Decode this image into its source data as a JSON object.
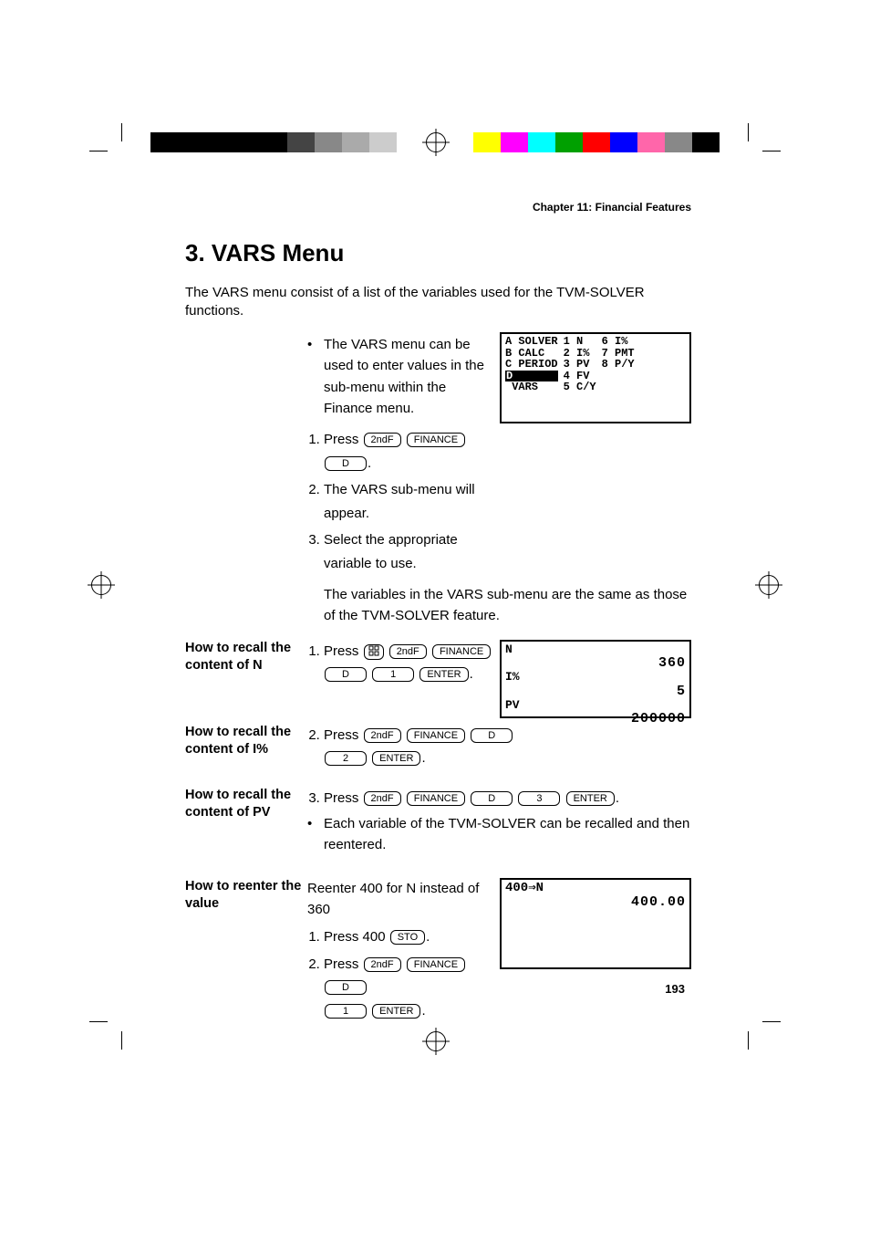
{
  "header": {
    "chapter": "Chapter 11: Financial Features"
  },
  "title": "3. VARS Menu",
  "intro": "The VARS menu consist of a list of the variables used for the TVM-SOLVER functions.",
  "bullet1": "The VARS menu can be used to enter values in the sub-menu within the Finance menu.",
  "steps_main": {
    "s1_a": "Press ",
    "s1_end": ".",
    "s2": "The VARS sub-menu will appear.",
    "s3": "Select the appropriate variable to use.",
    "note": "The variables in the VARS sub-menu are the same as those of the TVM-SOLVER feature."
  },
  "keys": {
    "secondF": "2ndF",
    "finance": "FINANCE",
    "D": "D",
    "one": "1",
    "two": "2",
    "three": "3",
    "enter": "ENTER",
    "sto": "STO"
  },
  "screen1": {
    "colA": [
      "A SOLVER",
      "B CALC",
      "C PERIOD",
      "D VARS"
    ],
    "colB": [
      "1 N",
      "2 I%",
      "3 PV",
      "4 FV",
      "5 C/Y"
    ],
    "colC": [
      "6 I%",
      "7 PMT",
      "8 P/Y"
    ]
  },
  "labels": {
    "recallN": "How to recall the content of N",
    "recallI": "How to recall the content of I%",
    "recallPV": "How to recall the content of PV",
    "reenter": "How to reenter the value"
  },
  "recallN": {
    "pre": "Press ",
    "post": "."
  },
  "recallI": {
    "pre": "Press ",
    "post": "."
  },
  "recallPV": {
    "pre": "Press ",
    "post": ".",
    "bullet": "Each variable of the TVM-SOLVER can be recalled and then reentered."
  },
  "reenter": {
    "heading": "Reenter 400 for N instead of 360",
    "s1_pre": "Press 400 ",
    "s1_post": ".",
    "s2_pre": "Press ",
    "s2_post": "."
  },
  "screen2": {
    "rows": [
      {
        "l": "N",
        "r": "360"
      },
      {
        "l": "I%",
        "r": "5"
      },
      {
        "l": "PV",
        "r": "200000"
      }
    ]
  },
  "screen3": {
    "line1_l": "400⇒N",
    "line1_r": "",
    "line2_r": "400.00"
  },
  "page_number": "193",
  "grey_shades": [
    "#000000",
    "#000000",
    "#000000",
    "#000000",
    "#000000",
    "#444444",
    "#888888",
    "#aaaaaa",
    "#cccccc"
  ],
  "color_swatches": [
    "#ffff00",
    "#ff00ff",
    "#00ffff",
    "#00a000",
    "#ff0000",
    "#0000ff",
    "#ff66aa",
    "#888888",
    "#000000"
  ]
}
